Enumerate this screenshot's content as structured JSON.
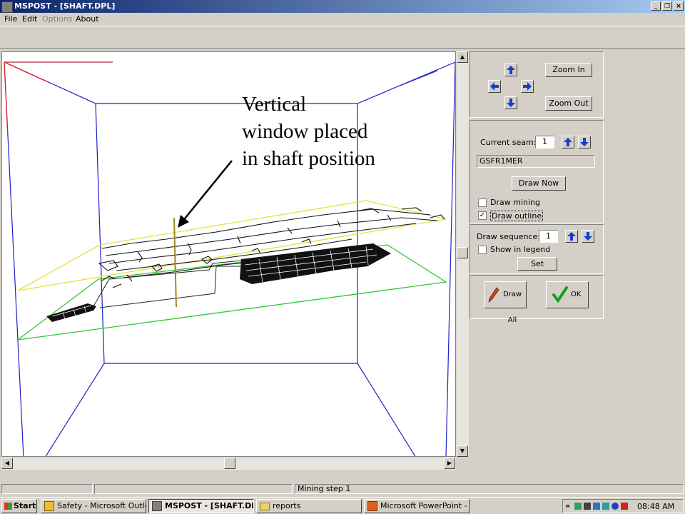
{
  "window": {
    "title": "MSPOST - [SHAFT.DPL]",
    "minimize_glyph": "_",
    "restore_glyph": "❐",
    "close_glyph": "×"
  },
  "menu": {
    "file": "File",
    "edit": "Edit",
    "options": "Options",
    "about": "About"
  },
  "annotation": {
    "line1": "Vertical",
    "line2": "window placed",
    "line3": "in shaft position"
  },
  "panel": {
    "zoom_in": "Zoom In",
    "zoom_out": "Zoom Out",
    "current_seam_label": "Current seam:",
    "current_seam_value": "1",
    "seam_name": "GSFR1MER",
    "draw_now": "Draw Now",
    "draw_mining_label": "Draw mining",
    "draw_mining_checked": false,
    "draw_outline_label": "Draw outline",
    "draw_outline_check": "✓",
    "draw_sequence_label": "Draw sequence:",
    "draw_sequence_value": "1",
    "show_in_legend_label": "Show in legend",
    "set": "Set",
    "draw_all": "Draw All",
    "ok": "OK"
  },
  "status": {
    "message": "Mining step 1"
  },
  "taskbar": {
    "start": "Start",
    "items": [
      {
        "label": "Safety - Microsoft Outlook"
      },
      {
        "label": "MSPOST - [SHAFT.DPL]"
      },
      {
        "label": "reports"
      },
      {
        "label": "Microsoft PowerPoint - [..."
      }
    ],
    "tray_chevron": "«",
    "clock": "08:48 AM"
  },
  "colors": {
    "titlebar_start": "#0a246a",
    "titlebar_end": "#a6caf0",
    "box_edges": "#2020c8",
    "upper_seam_outline": "#e8e040",
    "lower_seam_outline": "#30c830",
    "shaft_window": "#a08a20",
    "axis_red": "#e02020",
    "arrow_button_blue": "#1040d0"
  }
}
